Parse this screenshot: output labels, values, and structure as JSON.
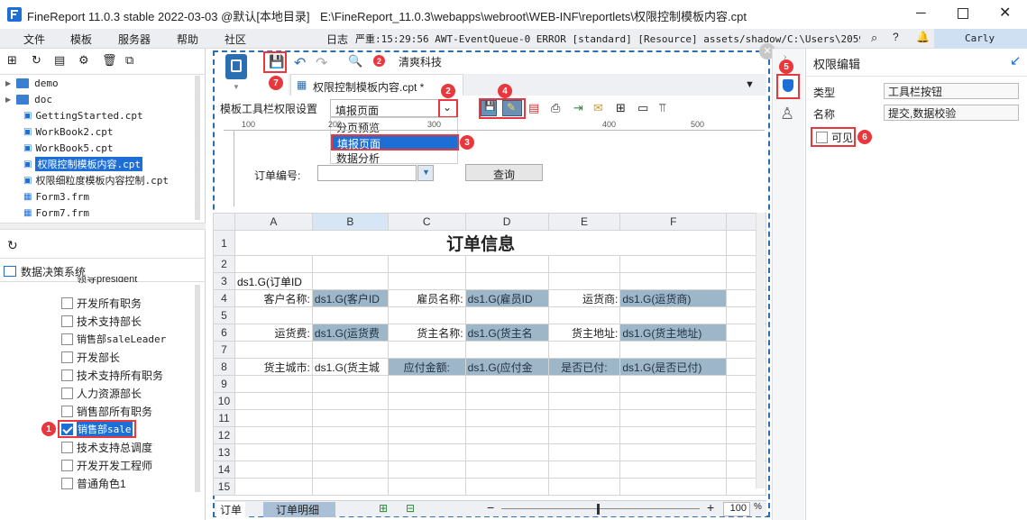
{
  "window": {
    "title": "FineReport 11.0.3 stable 2022-03-03 @默认[本地目录]",
    "path": "E:\\FineReport_11.0.3\\webapps\\webroot\\WEB-INF\\reportlets\\权限控制模板内容.cpt"
  },
  "menu": {
    "items": [
      "文件",
      "模板",
      "服务器",
      "帮助",
      "社区"
    ],
    "log_label": "日志",
    "log_text": "严重:15:29:56 AWT-EventQueue-0 ERROR [standard] [Resource] assets/shadow/C:\\Users\\20598\\De...",
    "user": "Carly"
  },
  "file_tree": {
    "items": [
      {
        "type": "folder",
        "name": "demo"
      },
      {
        "type": "folder",
        "name": "doc"
      },
      {
        "type": "file",
        "name": "GettingStarted.cpt"
      },
      {
        "type": "file",
        "name": "WorkBook2.cpt"
      },
      {
        "type": "file",
        "name": "WorkBook5.cpt"
      },
      {
        "type": "file",
        "name": "权限控制模板内容.cpt",
        "selected": true
      },
      {
        "type": "file",
        "name": "权限细粒度模板内容控制.cpt"
      },
      {
        "type": "file",
        "name": "Form3.frm"
      },
      {
        "type": "file",
        "name": "Form7.frm"
      }
    ]
  },
  "roles_panel": {
    "title": "数据决策系统",
    "partial_top": "领导president",
    "roles": [
      {
        "name": "开发所有职务",
        "checked": false
      },
      {
        "name": "技术支持部长",
        "checked": false
      },
      {
        "name": "销售部saleLeader",
        "checked": false
      },
      {
        "name": "开发部长",
        "checked": false
      },
      {
        "name": "技术支持所有职务",
        "checked": false
      },
      {
        "name": "人力资源部长",
        "checked": false
      },
      {
        "name": "销售部所有职务",
        "checked": false
      },
      {
        "name": "销售部sale",
        "checked": true,
        "selected": true
      },
      {
        "name": "技术支持总调度",
        "checked": false
      },
      {
        "name": "开发开发工程师",
        "checked": false
      },
      {
        "name": "普通角色1",
        "checked": false
      }
    ]
  },
  "editor": {
    "toolbar_button": "清爽科技",
    "tab_title": "权限控制模板内容.cpt *",
    "permission_label": "模板工具栏权限设置",
    "dropdown_value": "填报页面",
    "dropdown_options": [
      "分页预览",
      "填报页面",
      "数据分析"
    ],
    "ruler_ticks": [
      "100",
      "200",
      "300",
      "400",
      "500"
    ],
    "param_label": "订单编号:",
    "query_button": "查询"
  },
  "sheet": {
    "columns": [
      "A",
      "B",
      "C",
      "D",
      "E",
      "F"
    ],
    "rows": [
      "1",
      "2",
      "3",
      "4",
      "5",
      "6",
      "7",
      "8",
      "9",
      "10",
      "11",
      "12",
      "13",
      "14",
      "15"
    ],
    "title": "订单信息",
    "r3_b": "ds1.G(订单ID",
    "r4": [
      "客户名称:",
      "ds1.G(客户ID",
      "雇员名称:",
      "ds1.G(雇员ID",
      "运货商:",
      "ds1.G(运货商)"
    ],
    "r6": [
      "运货费:",
      "ds1.G(运货费",
      "货主名称:",
      "ds1.G(货主名",
      "货主地址:",
      "ds1.G(货主地址)"
    ],
    "r8": [
      "货主城市:",
      "ds1.G(货主城",
      "应付金额:",
      "ds1.G(应付金",
      "是否已付:",
      "ds1.G(是否已付)"
    ],
    "tabs": [
      "订单",
      "订单明细"
    ],
    "zoom": "100"
  },
  "right_panel": {
    "title": "权限编辑",
    "type_label": "类型",
    "type_value": "工具栏按钮",
    "name_label": "名称",
    "name_value": "提交,数据校验",
    "visible_label": "可见",
    "visible_checked": false
  },
  "markers": [
    "1",
    "2",
    "3",
    "4",
    "5",
    "6",
    "7"
  ],
  "colors": {
    "accent": "#1d6fd6",
    "marker": "#e8383d",
    "dashed": "#2b6fb3",
    "field": "#9db6c8"
  }
}
